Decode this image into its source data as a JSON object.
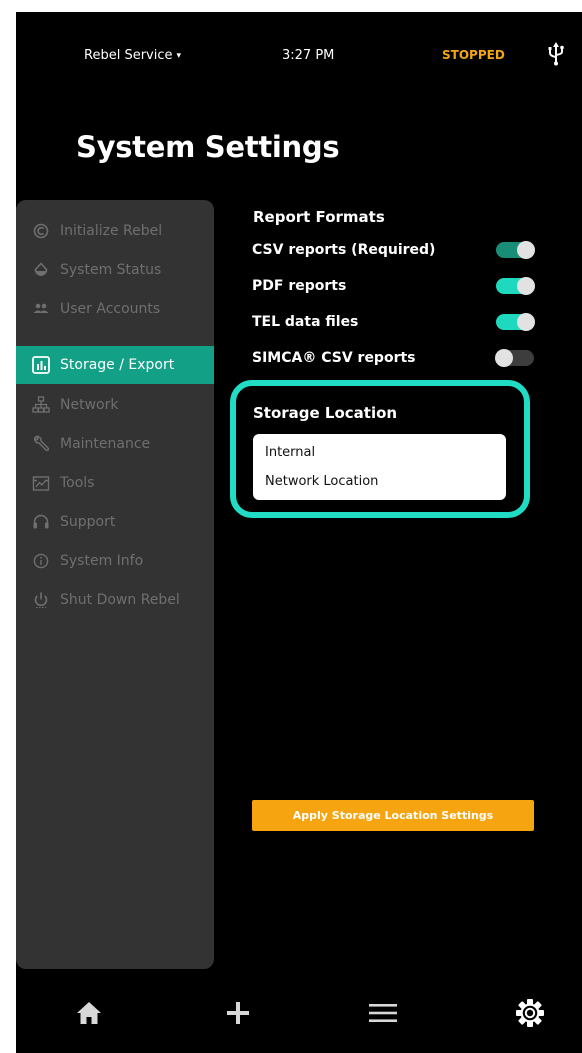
{
  "status_bar": {
    "user": "Rebel Service",
    "user_caret": "▾",
    "time": "3:27 PM",
    "state": "STOPPED",
    "usb_icon": "usb-icon"
  },
  "page_title": "System Settings",
  "sidebar": {
    "items": [
      {
        "label": "Initialize Rebel",
        "icon": "initialize-icon",
        "active": false
      },
      {
        "label": "System Status",
        "icon": "drop-icon",
        "active": false
      },
      {
        "label": "User Accounts",
        "icon": "users-icon",
        "active": false
      },
      {
        "label": "Storage / Export",
        "icon": "chart-icon",
        "active": true
      },
      {
        "label": "Network",
        "icon": "network-icon",
        "active": false
      },
      {
        "label": "Maintenance",
        "icon": "wrench-icon",
        "active": false
      },
      {
        "label": "Tools",
        "icon": "tools-icon",
        "active": false
      },
      {
        "label": "Support",
        "icon": "headset-icon",
        "active": false
      },
      {
        "label": "System Info",
        "icon": "info-icon",
        "active": false
      },
      {
        "label": "Shut Down Rebel",
        "icon": "power-icon",
        "active": false
      }
    ]
  },
  "report_formats": {
    "title": "Report Formats",
    "options": [
      {
        "label": "CSV reports (Required)",
        "state": "on-disabled"
      },
      {
        "label": "PDF reports",
        "state": "on"
      },
      {
        "label": "TEL data files",
        "state": "on"
      },
      {
        "label": "SIMCA® CSV reports",
        "state": "off"
      }
    ]
  },
  "storage_location": {
    "title": "Storage Location",
    "options": [
      "Internal",
      "Network Location"
    ]
  },
  "apply_button": "Apply Storage Location Settings",
  "bottom_nav": {
    "home": "home-icon",
    "add": "plus-icon",
    "menu": "menu-icon",
    "settings": "settings-icon"
  },
  "colors": {
    "accent": "#12a087",
    "toggle_on": "#1ed9bd",
    "highlight_border": "#21dcc4",
    "warning": "#f2a516",
    "sidebar_bg": "#333333"
  }
}
